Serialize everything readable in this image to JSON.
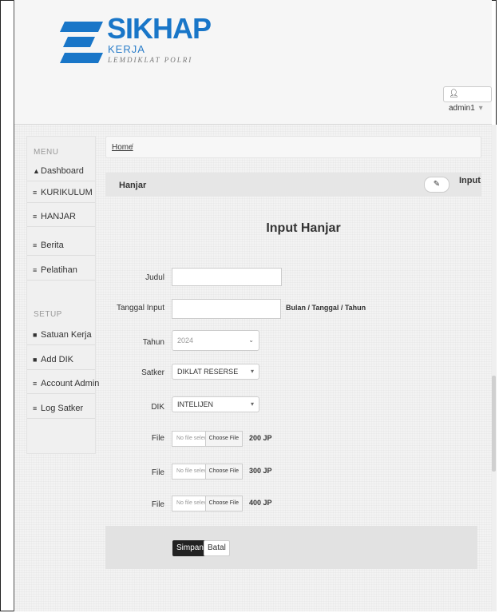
{
  "header": {
    "brand": "SIKHAP",
    "brand_sub": "KERJA",
    "brand_tagline": "LEMDIKLAT POLRI",
    "user_label": "admin1",
    "user_icon": "user-icon",
    "accent_color": "#1976c8"
  },
  "sidebar": {
    "menu_heading": "MENU",
    "menu_items": [
      {
        "label": "Dashboard",
        "icon": "home-icon"
      },
      {
        "label": "KURIKULUM",
        "icon": "list-icon"
      },
      {
        "label": "HANJAR",
        "icon": "list-icon"
      },
      {
        "label": "Berita",
        "icon": "list-icon"
      },
      {
        "label": "Pelatihan",
        "icon": "list-icon"
      }
    ],
    "setup_heading": "SETUP",
    "setup_items": [
      {
        "label": "Satuan Kerja",
        "icon": "flag-icon"
      },
      {
        "label": "Add DIK",
        "icon": "flag-icon"
      },
      {
        "label": "Account Admin",
        "icon": "list-icon"
      },
      {
        "label": "Log Satker",
        "icon": "list-icon"
      }
    ]
  },
  "breadcrumb": {
    "home": "Home",
    "separator": "/"
  },
  "panel": {
    "title": "Hanjar",
    "action_label": "Input",
    "action_icon": "edit-icon"
  },
  "form": {
    "title": "Input Hanjar",
    "judul_label": "Judul",
    "judul_value": "",
    "tanggal_label": "Tanggal Input",
    "tanggal_value": "",
    "tanggal_hint": "Bulan / Tanggal / Tahun",
    "tahun_label": "Tahun",
    "tahun_value": "2024",
    "satker_label": "Satker",
    "satker_value": "DIKLAT RESERSE",
    "dik_label": "DIK",
    "dik_value": "INTELIJEN",
    "files": [
      {
        "label": "File",
        "status": "No file selected",
        "button": "Choose File",
        "jp": "200 JP"
      },
      {
        "label": "File",
        "status": "No file selected",
        "button": "Choose File",
        "jp": "300 JP"
      },
      {
        "label": "File",
        "status": "No file selected",
        "button": "Choose File",
        "jp": "400 JP"
      }
    ],
    "save_label": "Simpan",
    "cancel_label": "Batal"
  }
}
